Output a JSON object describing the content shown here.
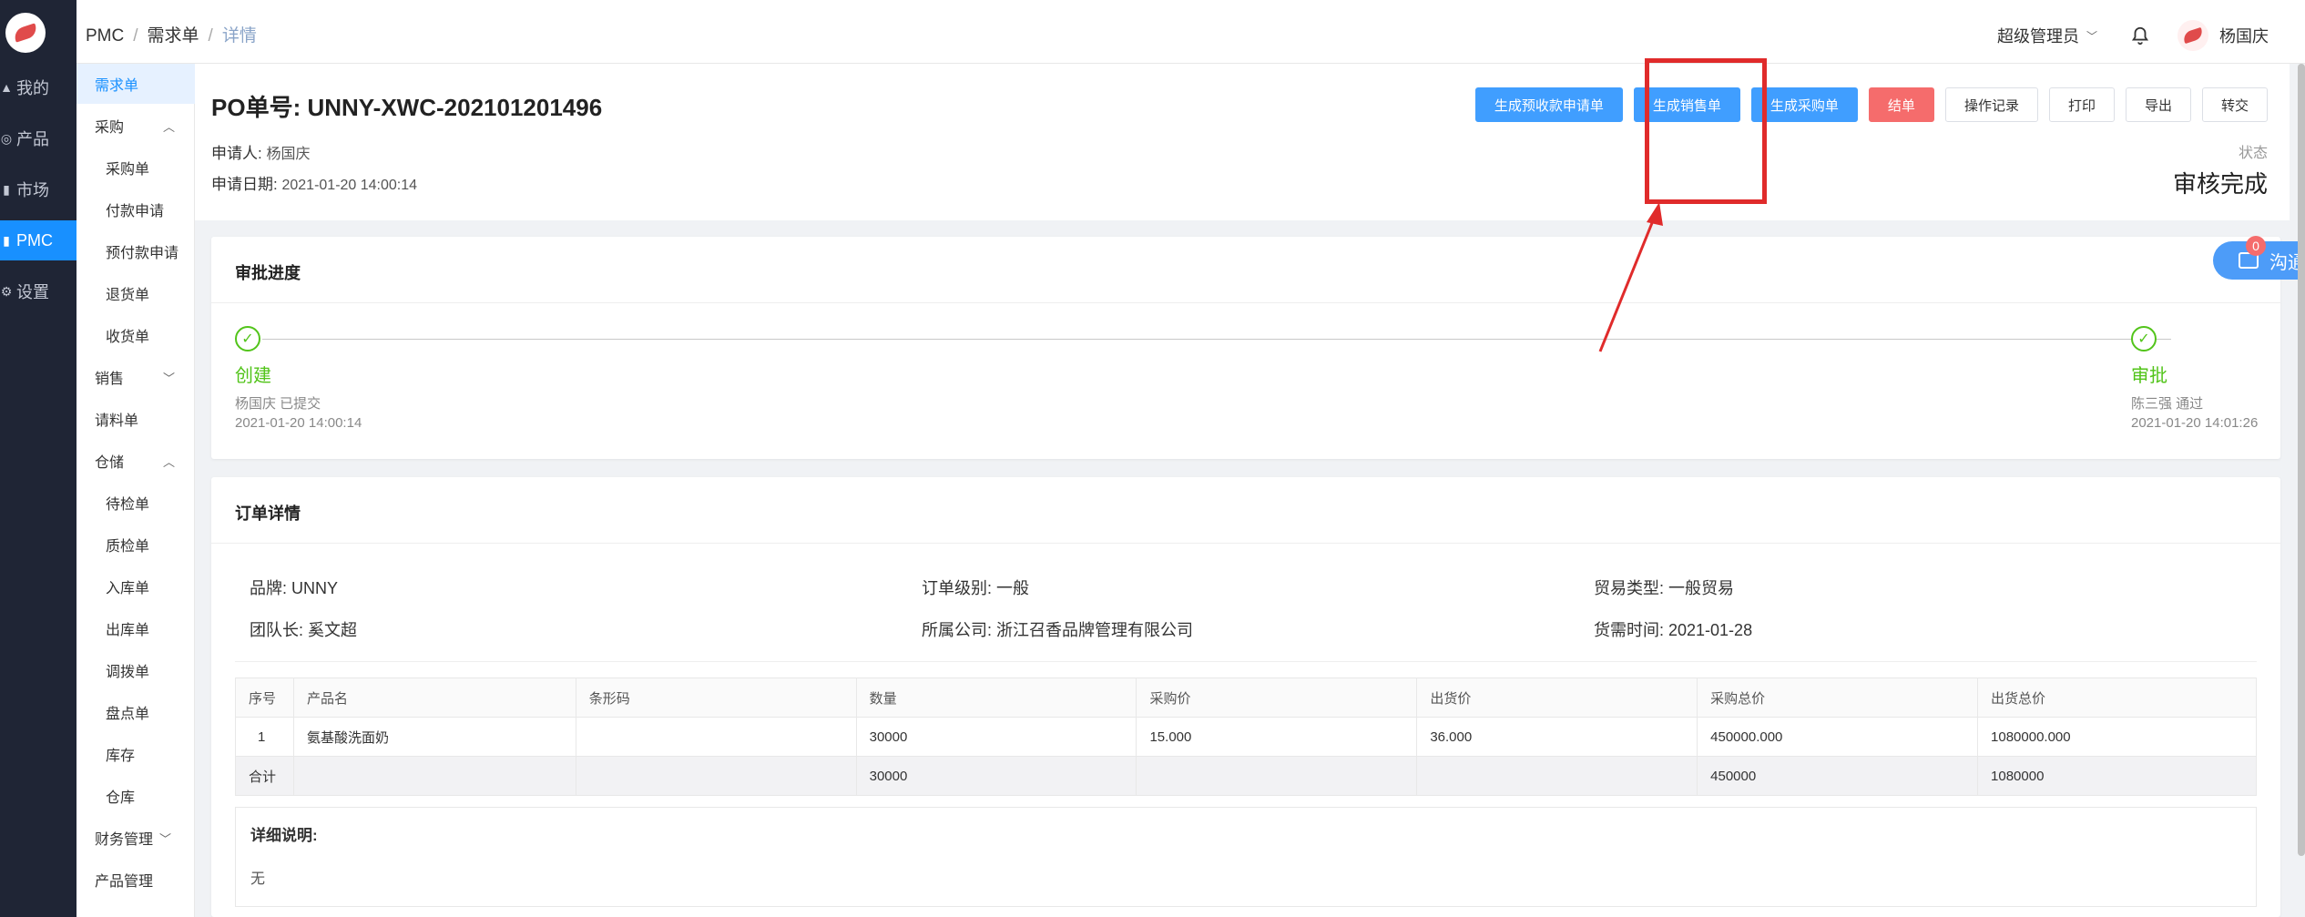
{
  "sidebar_main": [
    {
      "label": "我的",
      "icon": "user-icon"
    },
    {
      "label": "产品",
      "icon": "product-icon"
    },
    {
      "label": "市场",
      "icon": "market-icon"
    },
    {
      "label": "PMC",
      "icon": "pmc-icon",
      "active": true
    },
    {
      "label": "设置",
      "icon": "gear-icon"
    }
  ],
  "sidebar_sub": {
    "demand": "需求单",
    "purchase": "采购",
    "purchase_order": "采购单",
    "payment_request": "付款申请",
    "prepayment_request": "预付款申请",
    "return_order": "退货单",
    "receipt_order": "收货单",
    "sales": "销售",
    "material_request": "请料单",
    "warehouse": "仓储",
    "pending_inspection": "待检单",
    "quality_inspection": "质检单",
    "inbound": "入库单",
    "outbound": "出库单",
    "transfer": "调拨单",
    "stocktake": "盘点单",
    "inventory": "库存",
    "warehouse_list": "仓库",
    "finance": "财务管理",
    "product_mgmt": "产品管理"
  },
  "breadcrumb": {
    "a": "PMC",
    "b": "需求单",
    "c": "详情",
    "sep": "/"
  },
  "topbar": {
    "role": "超级管理员",
    "user": "杨国庆"
  },
  "header": {
    "po_title": "PO单号: UNNY-XWC-202101201496",
    "applicant_label": "申请人:",
    "applicant": "杨国庆",
    "date_label": "申请日期:",
    "date": "2021-01-20 14:00:14",
    "status_label": "状态",
    "status": "审核完成"
  },
  "buttons": {
    "gen_prepay": "生成预收款申请单",
    "gen_sales": "生成销售单",
    "gen_purchase": "生成采购单",
    "close_order": "结单",
    "op_log": "操作记录",
    "print": "打印",
    "export": "导出",
    "transfer": "转交"
  },
  "approval": {
    "title": "审批进度",
    "steps": [
      {
        "name": "创建",
        "who": "杨国庆 已提交",
        "time": "2021-01-20 14:00:14"
      },
      {
        "name": "审批",
        "who": "陈三强 通过",
        "time": "2021-01-20 14:01:26"
      }
    ]
  },
  "chat": {
    "label": "沟通",
    "count": "0"
  },
  "order": {
    "title": "订单详情",
    "brand": "品牌: UNNY",
    "level": "订单级别: 一般",
    "trade_type": "贸易类型: 一般贸易",
    "leader": "团队长: 奚文超",
    "company": "所属公司: 浙江召香品牌管理有限公司",
    "need_date": "货需时间: 2021-01-28",
    "columns": [
      "序号",
      "产品名",
      "条形码",
      "数量",
      "采购价",
      "出货价",
      "采购总价",
      "出货总价"
    ],
    "rows": [
      [
        "1",
        "氨基酸洗面奶",
        "",
        "30000",
        "15.000",
        "36.000",
        "450000.000",
        "1080000.000"
      ]
    ],
    "total": [
      "合计",
      "",
      "",
      "30000",
      "",
      "",
      "450000",
      "1080000"
    ],
    "desc_title": "详细说明:",
    "desc": "无"
  }
}
